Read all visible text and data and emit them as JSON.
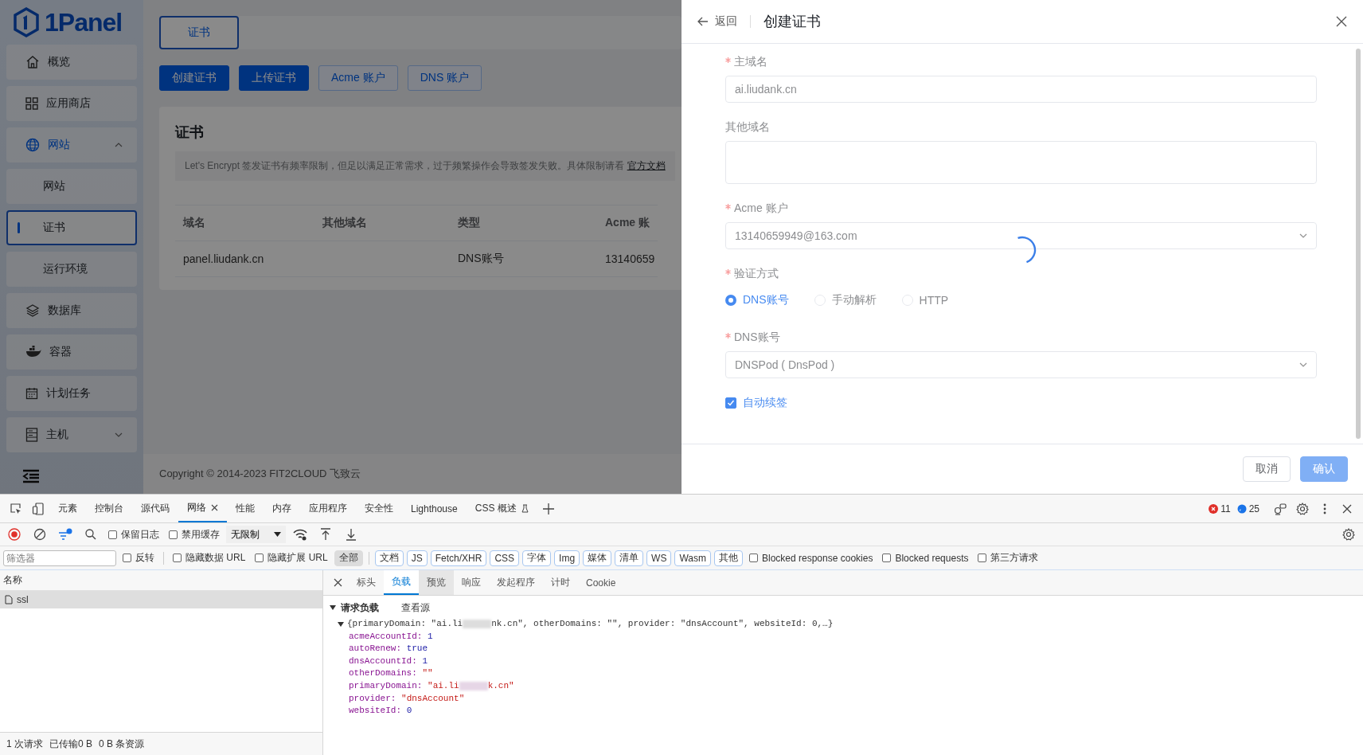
{
  "sidebar": {
    "logo": "1Panel",
    "items": [
      {
        "label": "概览",
        "selected": false
      },
      {
        "label": "应用商店",
        "selected": false
      },
      {
        "label": "网站",
        "selected": false,
        "expanded": true,
        "children": [
          {
            "label": "网站",
            "selected": false
          },
          {
            "label": "证书",
            "selected": true
          },
          {
            "label": "运行环境",
            "selected": false
          }
        ]
      },
      {
        "label": "数据库",
        "selected": false
      },
      {
        "label": "容器",
        "selected": false
      },
      {
        "label": "计划任务",
        "selected": false
      },
      {
        "label": "主机",
        "selected": false,
        "expanded": false
      }
    ]
  },
  "page_tabs": [
    {
      "label": "证书",
      "selected": true
    }
  ],
  "actions": [
    {
      "label": "创建证书",
      "kind": "primary"
    },
    {
      "label": "上传证书",
      "kind": "primary"
    },
    {
      "label": "Acme 账户",
      "kind": "plain"
    },
    {
      "label": "DNS 账户",
      "kind": "plain"
    }
  ],
  "card": {
    "title": "证书",
    "alert": {
      "text": "Let's Encrypt 签发证书有频率限制，但足以满足正常需求，过于频繁操作会导致签发失败。具体限制请看 ",
      "link": "官方文档"
    },
    "table": {
      "columns": [
        "域名",
        "其他域名",
        "类型",
        "Acme 账"
      ],
      "rows": [
        {
          "domain": "panel.liudank.cn",
          "type": "DNS账号",
          "acme_account": "13140659"
        }
      ]
    }
  },
  "footer": "Copyright © 2014-2023 FIT2CLOUD 飞致云",
  "drawer": {
    "back": "返回",
    "title": "创建证书",
    "loading": true,
    "fields": [
      {
        "kind": "input",
        "label": "主域名",
        "required": true,
        "value": "ai.liudank.cn"
      },
      {
        "kind": "textarea",
        "label": "其他域名",
        "required": false
      },
      {
        "kind": "select",
        "label": "Acme 账户",
        "required": true,
        "value": "13140659949@163.com"
      },
      {
        "kind": "radio",
        "label": "验证方式",
        "required": true,
        "options": [
          {
            "label": "DNS账号",
            "selected": true
          },
          {
            "label": "手动解析",
            "selected": false
          },
          {
            "label": "HTTP",
            "selected": false
          }
        ]
      },
      {
        "kind": "select",
        "label": "DNS账号",
        "required": true,
        "value": "DNSPod ( DnsPod )"
      },
      {
        "kind": "checkbox",
        "label": "自动续签",
        "checked": true
      }
    ],
    "buttons": [
      {
        "label": "取消",
        "kind": "plain"
      },
      {
        "label": "确认",
        "kind": "primary"
      }
    ]
  },
  "devtools": {
    "tabs": [
      {
        "label": "元素",
        "selected": false
      },
      {
        "label": "控制台",
        "selected": false
      },
      {
        "label": "源代码",
        "selected": false
      },
      {
        "label": "网络",
        "selected": true,
        "closable": true
      },
      {
        "label": "性能",
        "selected": false
      },
      {
        "label": "内存",
        "selected": false
      },
      {
        "label": "应用程序",
        "selected": false
      },
      {
        "label": "安全性",
        "selected": false
      },
      {
        "label": "Lighthouse",
        "selected": false
      },
      {
        "label": "CSS 概述",
        "selected": false,
        "experimental": true
      }
    ],
    "errors": "11",
    "messages": "25",
    "toolbar": {
      "recording": true,
      "checks": [
        {
          "label": "保留日志",
          "checked": false
        },
        {
          "label": "禁用缓存",
          "checked": false
        }
      ],
      "throttling": "无限制"
    },
    "filter": {
      "placeholder": "筛选器",
      "options": [
        {
          "label": "反转",
          "checked": false
        },
        {
          "label": "隐藏数据 URL",
          "checked": false
        },
        {
          "label": "隐藏扩展 URL",
          "checked": false
        }
      ],
      "types": [
        {
          "label": "全部",
          "selected": true
        },
        {
          "label": "文档",
          "selected": false
        },
        {
          "label": "JS",
          "selected": false
        },
        {
          "label": "Fetch/XHR",
          "selected": false
        },
        {
          "label": "CSS",
          "selected": false
        },
        {
          "label": "字体",
          "selected": false
        },
        {
          "label": "Img",
          "selected": false
        },
        {
          "label": "媒体",
          "selected": false
        },
        {
          "label": "清单",
          "selected": false
        },
        {
          "label": "WS",
          "selected": false
        },
        {
          "label": "Wasm",
          "selected": false
        },
        {
          "label": "其他",
          "selected": false
        }
      ],
      "extra": [
        {
          "label": "Blocked response cookies",
          "checked": false
        },
        {
          "label": "Blocked requests",
          "checked": false
        },
        {
          "label": "第三方请求",
          "checked": false
        }
      ]
    },
    "requests": {
      "column": "名称",
      "rows": [
        {
          "name": "ssl",
          "selected": true
        }
      ],
      "status": [
        "1 次请求",
        "已传输0 B",
        "0 B 条资源"
      ]
    },
    "detail": {
      "tabs": [
        {
          "label": "标头",
          "selected": false,
          "hovered": false
        },
        {
          "label": "负载",
          "selected": true,
          "hovered": false
        },
        {
          "label": "预览",
          "selected": false,
          "hovered": true
        },
        {
          "label": "响应",
          "selected": false,
          "hovered": false
        },
        {
          "label": "发起程序",
          "selected": false,
          "hovered": false
        },
        {
          "label": "计时",
          "selected": false,
          "hovered": false
        },
        {
          "label": "Cookie",
          "selected": false,
          "hovered": false
        }
      ],
      "section": {
        "title": "请求负载",
        "expanded": true,
        "view_source": "查看源"
      },
      "payload": {
        "expanded": true,
        "summary_before": "{primaryDomain: \"ai.li",
        "summary_after": "nk.cn\", otherDomains: \"\", provider: \"dnsAccount\", websiteId: 0,…}",
        "properties": [
          {
            "key": "acmeAccountId:",
            "value": "1",
            "kind": "number"
          },
          {
            "key": "autoRenew:",
            "value": "true",
            "kind": "boolean"
          },
          {
            "key": "dnsAccountId:",
            "value": "1",
            "kind": "number"
          },
          {
            "key": "otherDomains:",
            "value": "\"\"",
            "kind": "string"
          },
          {
            "key": "primaryDomain:",
            "value_before": "\"ai.li",
            "value_after": "k.cn\"",
            "kind": "string"
          },
          {
            "key": "provider:",
            "value": "\"dnsAccount\"",
            "kind": "string"
          },
          {
            "key": "websiteId:",
            "value": "0",
            "kind": "number"
          }
        ]
      }
    }
  }
}
